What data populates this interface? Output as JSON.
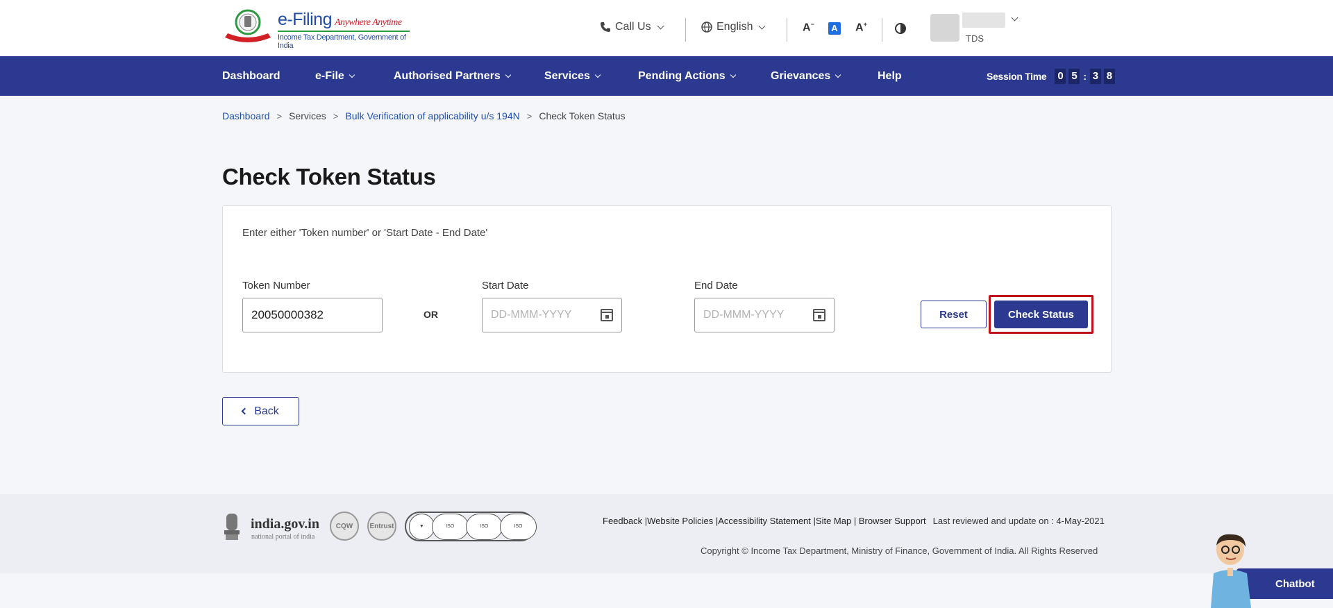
{
  "brand": {
    "title": "e-Filing",
    "tagline": "Anywhere Anytime",
    "subtitle": "Income Tax Department, Government of India"
  },
  "header": {
    "call_us": "Call Us",
    "language": "English",
    "font_decrease": "A",
    "font_normal": "A",
    "font_increase": "A",
    "user_role": "TDS"
  },
  "nav": {
    "items": [
      "Dashboard",
      "e-File",
      "Authorised Partners",
      "Services",
      "Pending Actions",
      "Grievances",
      "Help"
    ],
    "session_label": "Session Time",
    "session_digits": [
      "0",
      "5",
      "3",
      "8"
    ]
  },
  "breadcrumb": {
    "items": [
      "Dashboard",
      "Services",
      "Bulk Verification of applicability u/s 194N",
      "Check Token Status"
    ],
    "separator": ">"
  },
  "page": {
    "title": "Check Token Status"
  },
  "form": {
    "instruction": "Enter either 'Token number' or 'Start Date - End Date'",
    "token_label": "Token Number",
    "token_value": "20050000382",
    "or_label": "OR",
    "start_label": "Start Date",
    "start_placeholder": "DD-MMM-YYYY",
    "end_label": "End Date",
    "end_placeholder": "DD-MMM-YYYY",
    "reset_label": "Reset",
    "check_label": "Check Status"
  },
  "back_label": "Back",
  "footer": {
    "india_gov": "india.gov.in",
    "india_sub": "national portal of india",
    "links": [
      "Feedback",
      "Website Policies",
      "Accessibility Statement",
      "Site Map",
      "Browser Support"
    ],
    "reviewed": "Last reviewed and update on : 4-May-2021",
    "copyright": "Copyright © Income Tax Department, Ministry of Finance, Government of India. All Rights Reserved"
  },
  "chatbot": {
    "label": "Chatbot"
  },
  "colors": {
    "primary": "#2b3990",
    "highlight": "#c0121b",
    "link": "#1f4fb3"
  }
}
